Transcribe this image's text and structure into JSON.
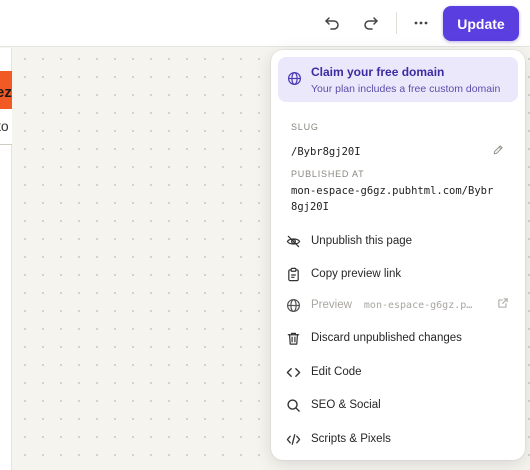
{
  "toolbar": {
    "undo_icon": "undo-icon",
    "redo_icon": "redo-icon",
    "more_icon": "more-horizontal-icon",
    "update_label": "Update",
    "accent": "#5b3ee0"
  },
  "canvas": {
    "peek_text_1": "ez",
    "peek_text_2": "to",
    "peek_color": "#f15a24"
  },
  "menu": {
    "promo": {
      "title": "Claim your free domain",
      "subtitle": "Your plan includes a free custom domain",
      "icon": "globe-icon"
    },
    "slug_label": "SLUG",
    "slug_value": "/Bybr8gj20I",
    "published_label": "PUBLISHED AT",
    "published_line1": "mon-espace-g6gz.pubhtml.com/Bybr",
    "published_line2": "8gj20I",
    "items": [
      {
        "label": "Unpublish this page",
        "icon": "eye-off-icon"
      },
      {
        "label": "Copy preview link",
        "icon": "clipboard-icon"
      },
      {
        "label": "Preview",
        "icon": "globe-icon",
        "url": "mon-espace-g6gz.p…",
        "disabled": true
      },
      {
        "label": "Discard unpublished changes",
        "icon": "trash-icon"
      },
      {
        "label": "Edit Code",
        "icon": "code-icon"
      },
      {
        "label": "SEO & Social",
        "icon": "search-icon"
      },
      {
        "label": "Scripts & Pixels",
        "icon": "code-slash-icon"
      }
    ]
  }
}
